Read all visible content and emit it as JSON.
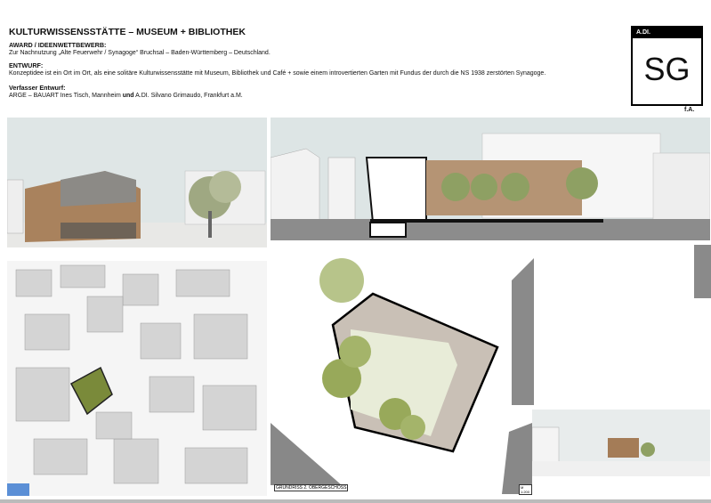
{
  "title": "KULTURWISSENSSTÄTTE – MUSEUM + BIBLIOTHEK",
  "sections": [
    {
      "heading": "AWARD / IDEENWETTBEWERB:",
      "text": "Zur Nachnutzung „Alte Feuerwehr / Synagoge“ Bruchsal – Baden-Württemberg – Deutschland."
    },
    {
      "heading": "ENTWURF:",
      "text": "Konzeptidee ist ein Ort im Ort, als eine solitäre Kulturwissensstätte mit Museum, Bibliothek und Café + sowie einem introvertierten Garten mit Fundus der durch die NS 1938 zerstörten Synagoge."
    },
    {
      "heading": "Verfasser Entwurf:",
      "text_pre": "ARGE – BAUART Ines Tisch, Mannheim ",
      "text_bold": "und",
      "text_post": " A.DI. Silvano Grimaudo, Frankfurt a.M."
    }
  ],
  "logo": {
    "top": "A.DI.",
    "mark": "SG",
    "suffix": "f.A."
  },
  "plan_label": "GRUNDRISS 2. OBERGESCHOSS",
  "scale_label": "M 1:200"
}
